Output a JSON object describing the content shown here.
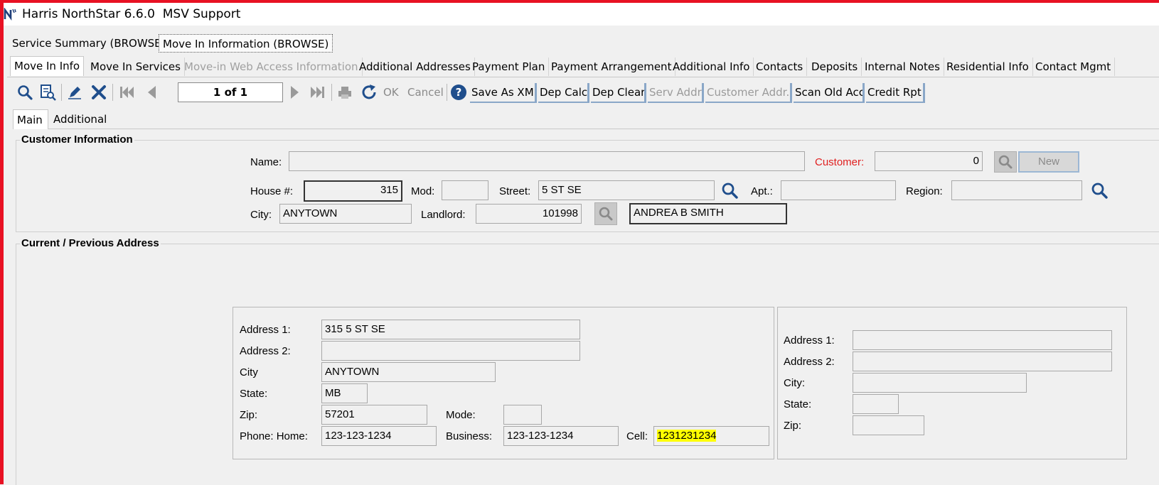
{
  "window": {
    "title": "Harris NorthStar 6.6.0  MSV Support"
  },
  "outer_tabs": [
    {
      "label": "Service Summary (BROWSE)"
    },
    {
      "label": "Move In Information (BROWSE)"
    }
  ],
  "inner_tabs": [
    {
      "label": "Move In Info"
    },
    {
      "label": "Move In Services"
    },
    {
      "label": "Move-in Web Access Information"
    },
    {
      "label": "Additional Addresses"
    },
    {
      "label": "Payment Plan"
    },
    {
      "label": "Payment Arrangement"
    },
    {
      "label": "Additional Info"
    },
    {
      "label": "Contacts"
    },
    {
      "label": "Deposits"
    },
    {
      "label": "Internal Notes"
    },
    {
      "label": "Residential Info"
    },
    {
      "label": "Contact Mgmt"
    }
  ],
  "toolbar": {
    "record_position": "1 of 1",
    "ok_label": "OK",
    "cancel_label": "Cancel",
    "buttons": [
      {
        "label": "Save As XML"
      },
      {
        "label": "Dep Calc"
      },
      {
        "label": "Dep Clear"
      },
      {
        "label": "Serv Addr"
      },
      {
        "label": "Customer Addr."
      },
      {
        "label": "Scan Old Acc"
      },
      {
        "label": "Credit Rpt"
      }
    ],
    "icons": [
      "search-icon",
      "report-search-icon",
      "edit-pencil-icon",
      "delete-x-icon",
      "first-record-icon",
      "previous-record-icon",
      "next-record-icon",
      "last-record-icon",
      "print-icon",
      "refresh-icon",
      "help-icon"
    ]
  },
  "sub_tabs": [
    {
      "label": "Main"
    },
    {
      "label": "Additional"
    }
  ],
  "customer_info": {
    "section_title": "Customer Information",
    "name_label": "Name:",
    "name_value": "",
    "customer_label": "Customer:",
    "customer_value": "0",
    "new_label": "New",
    "house_label": "House #:",
    "house_value": "315",
    "mod_label": "Mod:",
    "mod_value": "",
    "street_label": "Street:",
    "street_value": "5 ST SE",
    "apt_label": "Apt.:",
    "apt_value": "",
    "region_label": "Region:",
    "region_value": "",
    "city_label": "City:",
    "city_value": "ANYTOWN",
    "landlord_label": "Landlord:",
    "landlord_value": "101998",
    "landlord_name": "ANDREA B SMITH"
  },
  "current_address": {
    "section_title": "Current / Previous Address",
    "address1_label": "Address 1:",
    "address1_value": "315 5 ST SE",
    "address2_label": "Address 2:",
    "address2_value": "",
    "city_label": "City",
    "city_value": "ANYTOWN",
    "state_label": "State:",
    "state_value": "MB",
    "zip_label": "Zip:",
    "zip_value": "57201",
    "mode_label": "Mode:",
    "mode_value": "",
    "phone_home_label": "Phone: Home:",
    "phone_home_value": "123-123-1234",
    "business_label": "Business:",
    "business_value": "123-123-1234",
    "cell_label": "Cell:",
    "cell_value": "1231231234"
  },
  "previous_address": {
    "address1_label": "Address 1:",
    "address1_value": "",
    "address2_label": "Address 2:",
    "address2_value": "",
    "city_label": "City:",
    "city_value": "",
    "state_label": "State:",
    "state_value": "",
    "zip_label": "Zip:",
    "zip_value": ""
  },
  "colors": {
    "frame": "#e81123",
    "required_label": "#e02020",
    "highlight": "#ffff00",
    "icon_blue": "#1f4e8c"
  }
}
